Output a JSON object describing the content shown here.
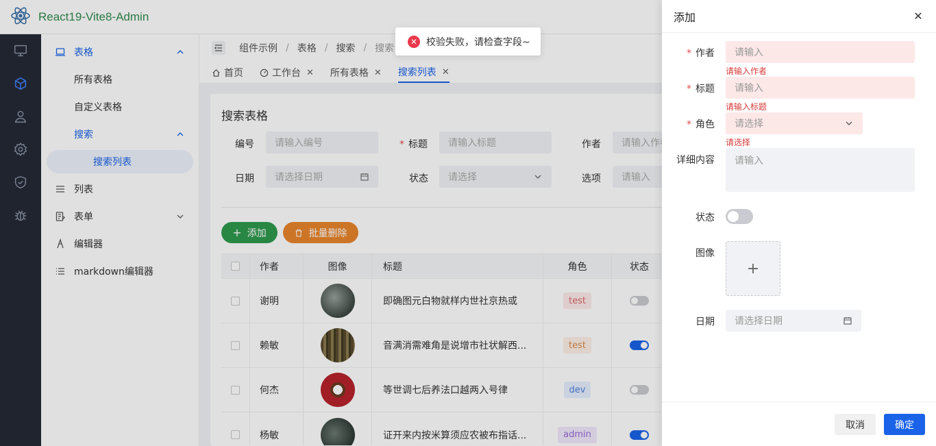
{
  "app": {
    "title": "React19-Vite8-Admin"
  },
  "rail": {
    "items": [
      "monitor-icon",
      "cube-icon",
      "user-icon",
      "gear-icon",
      "shield-icon",
      "bug-icon"
    ]
  },
  "menu": {
    "table_group": "表格",
    "all_tables": "所有表格",
    "custom_table": "自定义表格",
    "search_group": "搜索",
    "search_list": "搜索列表",
    "list": "列表",
    "form": "表单",
    "editor": "编辑器",
    "markdown": "markdown编辑器"
  },
  "breadcrumb": [
    "组件示例",
    "表格",
    "搜索",
    "搜索"
  ],
  "tabs": [
    {
      "label": "首页"
    },
    {
      "label": "工作台"
    },
    {
      "label": "所有表格"
    },
    {
      "label": "搜索列表"
    }
  ],
  "search_card": {
    "title": "搜索表格",
    "fields": {
      "id_label": "编号",
      "id_placeholder": "请输入编号",
      "title_label": "标题",
      "title_placeholder": "请输入标题",
      "author_label": "作者",
      "author_placeholder": "请输入作者",
      "date_label": "日期",
      "date_placeholder": "请选择日期",
      "status_label": "状态",
      "status_placeholder": "请选择",
      "option_label": "选项",
      "option_placeholder": "请输入"
    },
    "add_button": "添加",
    "batch_delete_button": "批量删除"
  },
  "table": {
    "headers": {
      "author": "作者",
      "image": "图像",
      "title": "标题",
      "role": "角色",
      "status": "状态"
    },
    "rows": [
      {
        "author": "谢明",
        "title": "即确图元白物就样内世社京热或",
        "role": "test",
        "status_on": false
      },
      {
        "author": "赖敏",
        "title": "音满消需难角是说增市社状解西...",
        "role": "test",
        "status_on": true
      },
      {
        "author": "何杰",
        "title": "等世调七后养法口越两入号律",
        "role": "dev",
        "status_on": false
      },
      {
        "author": "杨敏",
        "title": "证开来内按米算须应农被布指话...",
        "role": "admin",
        "status_on": true
      }
    ]
  },
  "toast": {
    "message": "校验失败，请检查字段~"
  },
  "drawer": {
    "title": "添加",
    "author_label": "作者",
    "author_placeholder": "请输入",
    "author_error": "请输入作者",
    "title_label": "标题",
    "title_placeholder": "请输入",
    "title_error": "请输入标题",
    "role_label": "角色",
    "role_placeholder": "请选择",
    "role_error": "请选择",
    "detail_label": "详细内容",
    "detail_placeholder": "请输入",
    "status_label": "状态",
    "image_label": "图像",
    "date_label": "日期",
    "date_placeholder": "请选择日期",
    "cancel_button": "取消",
    "ok_button": "确定"
  },
  "colors": {
    "primary": "#1a63e8",
    "success": "#2f9a4e",
    "warning": "#e9862c",
    "danger": "#e8394b"
  }
}
